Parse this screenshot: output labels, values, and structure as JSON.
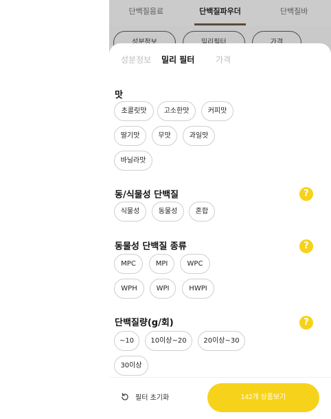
{
  "background": {
    "tabs": [
      "단백질음료",
      "단백질파우더",
      "단백질바"
    ],
    "active_tab": 1,
    "chips": [
      "성분정보",
      "밀리필터",
      "가격"
    ]
  },
  "sheet": {
    "tabs": [
      "성분정보",
      "밀리 필터",
      "가격"
    ],
    "active_tab": 1
  },
  "sections": {
    "taste": {
      "title": "맛",
      "options": [
        "초콜릿맛",
        "고소한맛",
        "커피맛",
        "딸기맛",
        "무맛",
        "과일맛",
        "바닐라맛"
      ]
    },
    "protein_source": {
      "title": "동/식물성 단백질",
      "options": [
        "식물성",
        "동물성",
        "혼합"
      ]
    },
    "animal_type": {
      "title": "동물성 단백질 종류",
      "options": [
        "MPC",
        "MPI",
        "WPC",
        "WPH",
        "WPI",
        "HWPI"
      ]
    },
    "amount": {
      "title": "단백질량(g/회)",
      "options": [
        "~10",
        "10이상~20",
        "20이상~30",
        "30이상"
      ]
    },
    "help_glyph": "?"
  },
  "footer": {
    "reset_label": "필터 초기화",
    "apply_label": "142개 상품보기"
  },
  "colors": {
    "accent": "#f7d21a",
    "overlay": "#c9c9c9"
  },
  "icons": {
    "help": "question-circle-icon",
    "reset": "refresh-icon"
  }
}
